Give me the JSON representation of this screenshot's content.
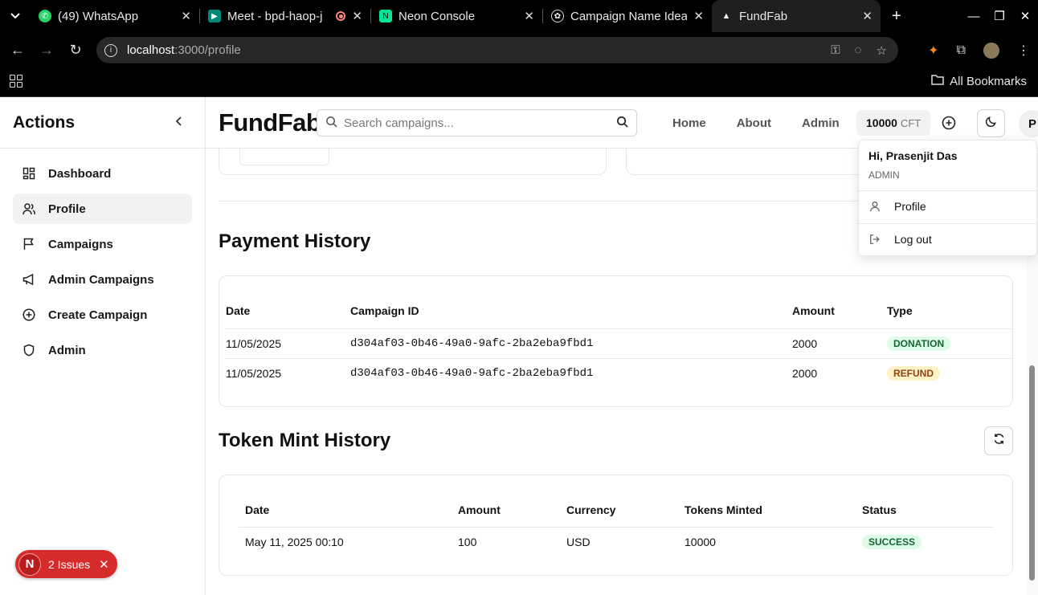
{
  "browser": {
    "tabs": [
      {
        "label": "(49) WhatsApp",
        "icon": "whatsapp-icon",
        "color": "#25d366"
      },
      {
        "label": "Meet - bpd-haop-j",
        "icon": "meet-icon",
        "color": "#00897b",
        "recording": true
      },
      {
        "label": "Neon Console",
        "icon": "neon-icon",
        "color": "#00e599"
      },
      {
        "label": "Campaign Name Idea",
        "icon": "openai-icon",
        "color": "#ffffff"
      },
      {
        "label": "FundFab",
        "icon": "vercel-icon",
        "color": "#ffffff",
        "active": true
      }
    ],
    "url_host": "localhost",
    "url_path": ":3000/profile",
    "bookmarks_label": "All Bookmarks"
  },
  "sidebar": {
    "title": "Actions",
    "items": [
      {
        "label": "Dashboard",
        "icon": "dashboard-icon"
      },
      {
        "label": "Profile",
        "icon": "users-icon",
        "active": true
      },
      {
        "label": "Campaigns",
        "icon": "flag-icon"
      },
      {
        "label": "Admin Campaigns",
        "icon": "megaphone-icon"
      },
      {
        "label": "Create Campaign",
        "icon": "plus-circle-icon"
      },
      {
        "label": "Admin",
        "icon": "shield-icon"
      }
    ]
  },
  "header": {
    "brand": "FundFab",
    "search_placeholder": "Search campaigns...",
    "nav": [
      "Home",
      "About",
      "Admin"
    ],
    "token_balance": "10000",
    "token_unit": "CFT",
    "avatar_initial": "P"
  },
  "user_menu": {
    "greeting": "Hi, Prasenjit Das",
    "role": "ADMIN",
    "profile_label": "Profile",
    "logout_label": "Log out"
  },
  "payment_history": {
    "title": "Payment History",
    "columns": [
      "Date",
      "Campaign ID",
      "Amount",
      "Type"
    ],
    "rows": [
      {
        "date": "11/05/2025",
        "campaign_id": "d304af03-0b46-49a0-9afc-2ba2eba9fbd1",
        "amount": "2000",
        "type": "DONATION"
      },
      {
        "date": "11/05/2025",
        "campaign_id": "d304af03-0b46-49a0-9afc-2ba2eba9fbd1",
        "amount": "2000",
        "type": "REFUND"
      }
    ]
  },
  "token_mint_history": {
    "title": "Token Mint History",
    "columns": [
      "Date",
      "Amount",
      "Currency",
      "Tokens Minted",
      "Status"
    ],
    "rows": [
      {
        "date": "May 11, 2025 00:10",
        "amount": "100",
        "currency": "USD",
        "tokens": "10000",
        "status": "SUCCESS"
      }
    ]
  },
  "issues_badge": {
    "initial": "N",
    "label": "2 Issues"
  },
  "colors": {
    "success_bg": "#dcfce7",
    "warning_bg": "#fef3c7",
    "issues_red": "#d62b2b"
  }
}
